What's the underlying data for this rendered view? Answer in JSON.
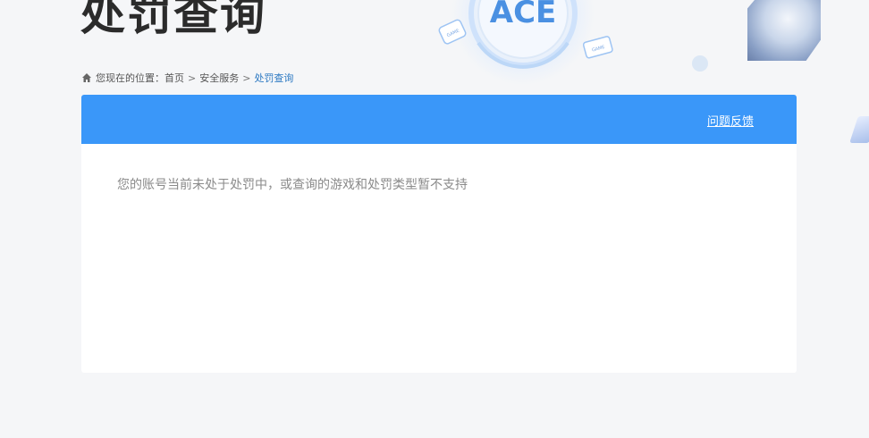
{
  "page": {
    "title": "处罚查询"
  },
  "logo": {
    "main": "ACE",
    "badge_left": "GAME",
    "badge_right": "GAME"
  },
  "breadcrumb": {
    "prefix": "您现在的位置：",
    "items": [
      "首页",
      "安全服务",
      "处罚查询"
    ],
    "separator": ">"
  },
  "panel": {
    "feedback_label": "问题反馈",
    "message": "您的账号当前未处于处罚中，或查询的游戏和处罚类型暂不支持"
  },
  "colors": {
    "accent": "#3a97f9",
    "breadcrumb_active": "#2b78c2",
    "title": "#2b2b2b",
    "message": "#8a8a8a",
    "background": "#f5f6f8"
  },
  "icons": {
    "breadcrumb": "home-icon"
  }
}
